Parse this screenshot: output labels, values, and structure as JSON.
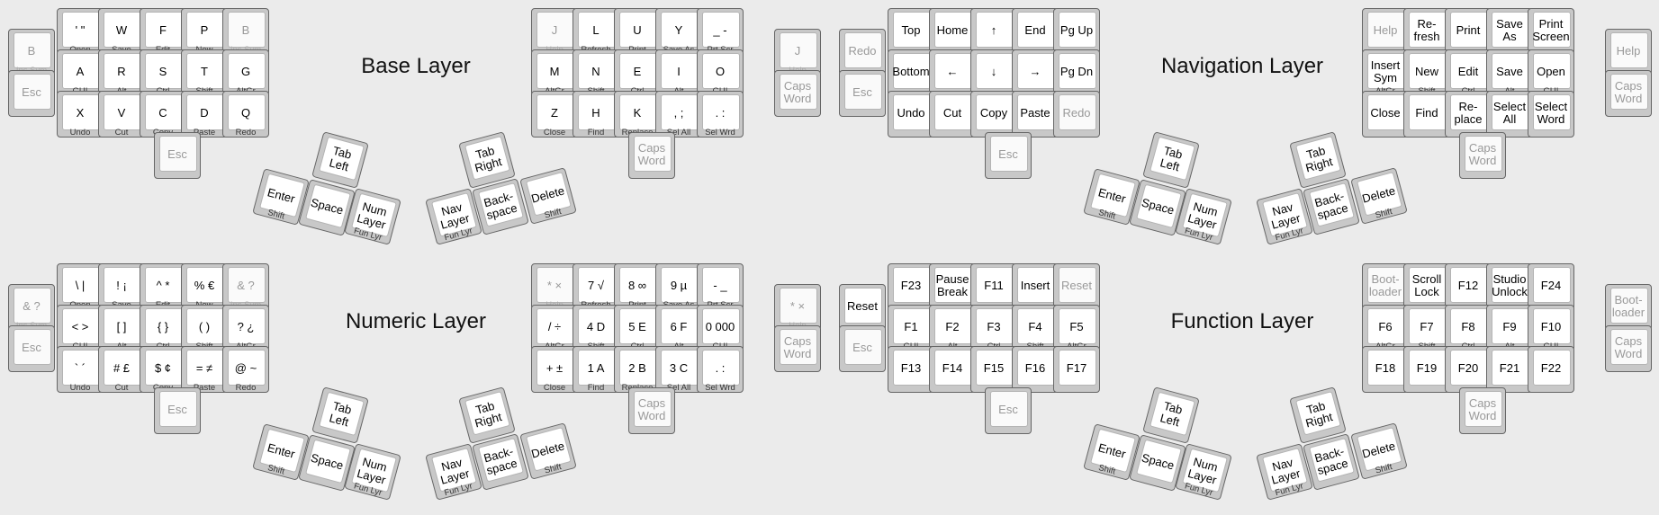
{
  "layers": [
    {
      "title": "Base Layer",
      "keys": [
        {
          "tap": "' \"",
          "hold": "Open"
        },
        {
          "tap": "W",
          "hold": "Save"
        },
        {
          "tap": "F",
          "hold": "Edit"
        },
        {
          "tap": "P",
          "hold": "New"
        },
        {
          "tap": "B",
          "hold": "Ins Sym",
          "dim": true
        },
        {
          "tap": "B",
          "hold": "Ins Sym",
          "dim": true
        },
        {
          "tap": "A",
          "hold": "GUI"
        },
        {
          "tap": "R",
          "hold": "Alt"
        },
        {
          "tap": "S",
          "hold": "Ctrl"
        },
        {
          "tap": "T",
          "hold": "Shift"
        },
        {
          "tap": "G",
          "hold": "AltGr"
        },
        {
          "tap": "Esc",
          "hold": "",
          "dim": true
        },
        {
          "tap": "X",
          "hold": "Undo"
        },
        {
          "tap": "V",
          "hold": "Cut"
        },
        {
          "tap": "C",
          "hold": "Copy"
        },
        {
          "tap": "D",
          "hold": "Paste"
        },
        {
          "tap": "Q",
          "hold": "Redo"
        },
        {
          "tap": "Esc",
          "hold": "",
          "dim": true
        },
        {
          "tap": "Tab\nLeft",
          "hold": ""
        },
        {
          "tap": "Enter",
          "hold": "Shift"
        },
        {
          "tap": "Space",
          "hold": ""
        },
        {
          "tap": "Num\nLayer",
          "hold": "Fun Lyr"
        },
        {
          "tap": "J",
          "hold": "Help",
          "dim": true
        },
        {
          "tap": "L",
          "hold": "Refresh"
        },
        {
          "tap": "U",
          "hold": "Print"
        },
        {
          "tap": "Y",
          "hold": "Save As"
        },
        {
          "tap": "_ -",
          "hold": "Prt Scr"
        },
        {
          "tap": "M",
          "hold": "AltGr"
        },
        {
          "tap": "N",
          "hold": "Shift"
        },
        {
          "tap": "E",
          "hold": "Ctrl"
        },
        {
          "tap": "I",
          "hold": "Alt"
        },
        {
          "tap": "O",
          "hold": "GUI"
        },
        {
          "tap": "J",
          "hold": "Help",
          "dim": true
        },
        {
          "tap": "Z",
          "hold": "Close"
        },
        {
          "tap": "H",
          "hold": "Find"
        },
        {
          "tap": "K",
          "hold": "Replace"
        },
        {
          "tap": ", ;",
          "hold": "Sel All"
        },
        {
          "tap": ". :",
          "hold": "Sel Wrd"
        },
        {
          "tap": "Caps\nWord",
          "hold": "",
          "dim": true
        },
        {
          "tap": "Caps\nWord",
          "hold": "",
          "dim": true
        },
        {
          "tap": "Tab\nRight",
          "hold": ""
        },
        {
          "tap": "Nav\nLayer",
          "hold": "Fun Lyr"
        },
        {
          "tap": "Back-\nspace",
          "hold": ""
        },
        {
          "tap": "Delete",
          "hold": "Shift"
        }
      ]
    },
    {
      "title": "Navigation Layer",
      "keys": [
        {
          "tap": "Top",
          "hold": ""
        },
        {
          "tap": "Home",
          "hold": ""
        },
        {
          "tap": "↑",
          "hold": ""
        },
        {
          "tap": "End",
          "hold": ""
        },
        {
          "tap": "Pg Up",
          "hold": ""
        },
        {
          "tap": "Redo",
          "hold": "",
          "dim": true
        },
        {
          "tap": "Bottom",
          "hold": ""
        },
        {
          "tap": "←",
          "hold": ""
        },
        {
          "tap": "↓",
          "hold": ""
        },
        {
          "tap": "→",
          "hold": ""
        },
        {
          "tap": "Pg Dn",
          "hold": ""
        },
        {
          "tap": "Esc",
          "hold": "",
          "dim": true
        },
        {
          "tap": "Undo",
          "hold": ""
        },
        {
          "tap": "Cut",
          "hold": ""
        },
        {
          "tap": "Copy",
          "hold": ""
        },
        {
          "tap": "Paste",
          "hold": ""
        },
        {
          "tap": "Redo",
          "hold": "",
          "dim": true
        },
        {
          "tap": "Esc",
          "hold": "",
          "dim": true
        },
        {
          "tap": "Tab\nLeft",
          "hold": ""
        },
        {
          "tap": "Enter",
          "hold": "Shift"
        },
        {
          "tap": "Space",
          "hold": ""
        },
        {
          "tap": "Num\nLayer",
          "hold": "Fun Lyr"
        },
        {
          "tap": "Help",
          "hold": "",
          "dim": true
        },
        {
          "tap": "Re-\nfresh",
          "hold": ""
        },
        {
          "tap": "Print",
          "hold": ""
        },
        {
          "tap": "Save\nAs",
          "hold": ""
        },
        {
          "tap": "Print\nScreen",
          "hold": ""
        },
        {
          "tap": "Insert\nSym",
          "hold": "AltGr"
        },
        {
          "tap": "New",
          "hold": "Shift"
        },
        {
          "tap": "Edit",
          "hold": "Ctrl"
        },
        {
          "tap": "Save",
          "hold": "Alt"
        },
        {
          "tap": "Open",
          "hold": "GUI"
        },
        {
          "tap": "Help",
          "hold": "",
          "dim": true
        },
        {
          "tap": "Close",
          "hold": ""
        },
        {
          "tap": "Find",
          "hold": ""
        },
        {
          "tap": "Re-\nplace",
          "hold": ""
        },
        {
          "tap": "Select\nAll",
          "hold": ""
        },
        {
          "tap": "Select\nWord",
          "hold": ""
        },
        {
          "tap": "Caps\nWord",
          "hold": "",
          "dim": true
        },
        {
          "tap": "Caps\nWord",
          "hold": "",
          "dim": true
        },
        {
          "tap": "Tab\nRight",
          "hold": ""
        },
        {
          "tap": "Nav\nLayer",
          "hold": "Fun Lyr"
        },
        {
          "tap": "Back-\nspace",
          "hold": ""
        },
        {
          "tap": "Delete",
          "hold": "Shift"
        }
      ]
    },
    {
      "title": "Numeric Layer",
      "keys": [
        {
          "tap": "\\ |",
          "hold": "Open"
        },
        {
          "tap": "! ¡",
          "hold": "Save"
        },
        {
          "tap": "^ *",
          "hold": "Edit"
        },
        {
          "tap": "% €",
          "hold": "New"
        },
        {
          "tap": "& ?",
          "hold": "Ins Sym",
          "dim": true
        },
        {
          "tap": "& ?",
          "hold": "Ins Sym",
          "dim": true
        },
        {
          "tap": "< >",
          "hold": "GUI"
        },
        {
          "tap": "[ ]",
          "hold": "Alt"
        },
        {
          "tap": "{ }",
          "hold": "Ctrl"
        },
        {
          "tap": "( )",
          "hold": "Shift"
        },
        {
          "tap": "? ¿",
          "hold": "AltGr"
        },
        {
          "tap": "Esc",
          "hold": "",
          "dim": true
        },
        {
          "tap": "` ´",
          "hold": "Undo"
        },
        {
          "tap": "# £",
          "hold": "Cut"
        },
        {
          "tap": "$ ¢",
          "hold": "Copy"
        },
        {
          "tap": "= ≠",
          "hold": "Paste"
        },
        {
          "tap": "@ ~",
          "hold": "Redo"
        },
        {
          "tap": "Esc",
          "hold": "",
          "dim": true
        },
        {
          "tap": "Tab\nLeft",
          "hold": ""
        },
        {
          "tap": "Enter",
          "hold": "Shift"
        },
        {
          "tap": "Space",
          "hold": ""
        },
        {
          "tap": "Num\nLayer",
          "hold": "Fun Lyr"
        },
        {
          "tap": "* ×",
          "hold": "Help",
          "dim": true
        },
        {
          "tap": "7 √",
          "hold": "Refresh"
        },
        {
          "tap": "8 ∞",
          "hold": "Print"
        },
        {
          "tap": "9 µ",
          "hold": "Save As"
        },
        {
          "tap": "- _",
          "hold": "Prt Scr"
        },
        {
          "tap": "/ ÷",
          "hold": "AltGr"
        },
        {
          "tap": "4 D",
          "hold": "Shift"
        },
        {
          "tap": "5 E",
          "hold": "Ctrl"
        },
        {
          "tap": "6 F",
          "hold": "Alt"
        },
        {
          "tap": "0 000",
          "hold": "GUI"
        },
        {
          "tap": "* ×",
          "hold": "Help",
          "dim": true
        },
        {
          "tap": "+ ±",
          "hold": "Close"
        },
        {
          "tap": "1 A",
          "hold": "Find"
        },
        {
          "tap": "2 B",
          "hold": "Replace"
        },
        {
          "tap": "3 C",
          "hold": "Sel All"
        },
        {
          "tap": ". :",
          "hold": "Sel Wrd"
        },
        {
          "tap": "Caps\nWord",
          "hold": "",
          "dim": true
        },
        {
          "tap": "Caps\nWord",
          "hold": "",
          "dim": true
        },
        {
          "tap": "Tab\nRight",
          "hold": ""
        },
        {
          "tap": "Nav\nLayer",
          "hold": "Fun Lyr"
        },
        {
          "tap": "Back-\nspace",
          "hold": ""
        },
        {
          "tap": "Delete",
          "hold": "Shift"
        }
      ]
    },
    {
      "title": "Function Layer",
      "keys": [
        {
          "tap": "F23",
          "hold": ""
        },
        {
          "tap": "Pause\nBreak",
          "hold": ""
        },
        {
          "tap": "F11",
          "hold": ""
        },
        {
          "tap": "Insert",
          "hold": ""
        },
        {
          "tap": "Reset",
          "hold": "",
          "dim": true
        },
        {
          "tap": "Reset",
          "hold": ""
        },
        {
          "tap": "F1",
          "hold": "GUI"
        },
        {
          "tap": "F2",
          "hold": "Alt"
        },
        {
          "tap": "F3",
          "hold": "Ctrl"
        },
        {
          "tap": "F4",
          "hold": "Shift"
        },
        {
          "tap": "F5",
          "hold": "AltGr"
        },
        {
          "tap": "Esc",
          "hold": "",
          "dim": true
        },
        {
          "tap": "F13",
          "hold": ""
        },
        {
          "tap": "F14",
          "hold": ""
        },
        {
          "tap": "F15",
          "hold": ""
        },
        {
          "tap": "F16",
          "hold": ""
        },
        {
          "tap": "F17",
          "hold": ""
        },
        {
          "tap": "Esc",
          "hold": "",
          "dim": true
        },
        {
          "tap": "Tab\nLeft",
          "hold": ""
        },
        {
          "tap": "Enter",
          "hold": "Shift"
        },
        {
          "tap": "Space",
          "hold": ""
        },
        {
          "tap": "Num\nLayer",
          "hold": "Fun Lyr"
        },
        {
          "tap": "Boot-\nloader",
          "hold": "",
          "dim": true
        },
        {
          "tap": "Scroll\nLock",
          "hold": ""
        },
        {
          "tap": "F12",
          "hold": ""
        },
        {
          "tap": "Studio\nUnlock",
          "hold": ""
        },
        {
          "tap": "F24",
          "hold": ""
        },
        {
          "tap": "F6",
          "hold": "AltGr"
        },
        {
          "tap": "F7",
          "hold": "Shift"
        },
        {
          "tap": "F8",
          "hold": "Ctrl"
        },
        {
          "tap": "F9",
          "hold": "Alt"
        },
        {
          "tap": "F10",
          "hold": "GUI"
        },
        {
          "tap": "Boot-\nloader",
          "hold": "",
          "dim": true
        },
        {
          "tap": "F18",
          "hold": ""
        },
        {
          "tap": "F19",
          "hold": ""
        },
        {
          "tap": "F20",
          "hold": ""
        },
        {
          "tap": "F21",
          "hold": ""
        },
        {
          "tap": "F22",
          "hold": ""
        },
        {
          "tap": "Caps\nWord",
          "hold": "",
          "dim": true
        },
        {
          "tap": "Caps\nWord",
          "hold": "",
          "dim": true
        },
        {
          "tap": "Tab\nRight",
          "hold": ""
        },
        {
          "tap": "Nav\nLayer",
          "hold": "Fun Lyr"
        },
        {
          "tap": "Back-\nspace",
          "hold": ""
        },
        {
          "tap": "Delete",
          "hold": "Shift"
        }
      ]
    }
  ]
}
